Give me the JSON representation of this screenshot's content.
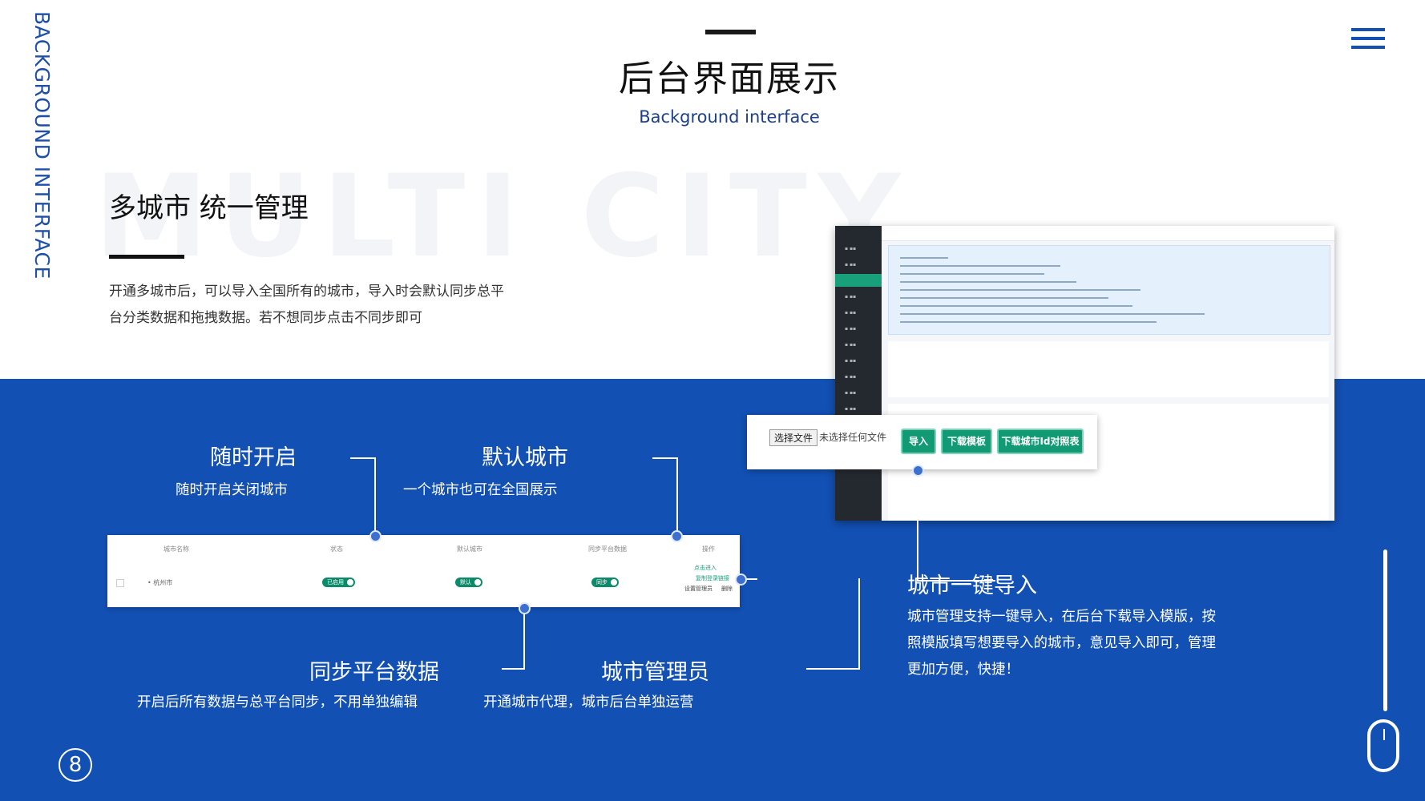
{
  "side_title": "BACKGROUND INTERFACE",
  "header": {
    "title": "后台界面展示",
    "subtitle": "Background interface"
  },
  "watermark": "MULTI CITY",
  "feature": {
    "title": "多城市 统一管理",
    "description": "开通多城市后，可以导入全国所有的城市，导入时会默认同步总平台分类数据和拖拽数据。若不想同步点击不同步即可"
  },
  "labels": {
    "open_anytime": {
      "title": "随时开启",
      "sub": "随时开启关闭城市"
    },
    "default_city": {
      "title": "默认城市",
      "sub": "一个城市也可在全国展示"
    },
    "sync_platform": {
      "title": "同步平台数据",
      "sub": "开启后所有数据与总平台同步，不用单独编辑"
    },
    "city_admin": {
      "title": "城市管理员",
      "sub": "开通城市代理，城市后台单独运营"
    },
    "one_click_import": {
      "title": "城市一键导入",
      "desc": "城市管理支持一键导入，在后台下载导入模版，按照模版填写想要导入的城市，意见导入即可，管理更加方便，快捷！"
    }
  },
  "table": {
    "headers": [
      "城市名称",
      "状态",
      "默认城市",
      "同步平台数据",
      "操作"
    ],
    "row": {
      "city": "• 杭州市",
      "status": "已启用",
      "default": "默认",
      "sync": "同步",
      "actions": [
        "点击进入",
        "复制登录链接",
        "设置管理员",
        "删除"
      ]
    }
  },
  "upload": {
    "choose": "选择文件",
    "none": "未选择任何文件",
    "btn_import": "导入",
    "btn_template": "下载模板",
    "btn_idtable": "下载城市Id对照表"
  },
  "page_number": "8",
  "colors": {
    "brand_blue": "#1250b4",
    "accent_green": "#129a74"
  }
}
